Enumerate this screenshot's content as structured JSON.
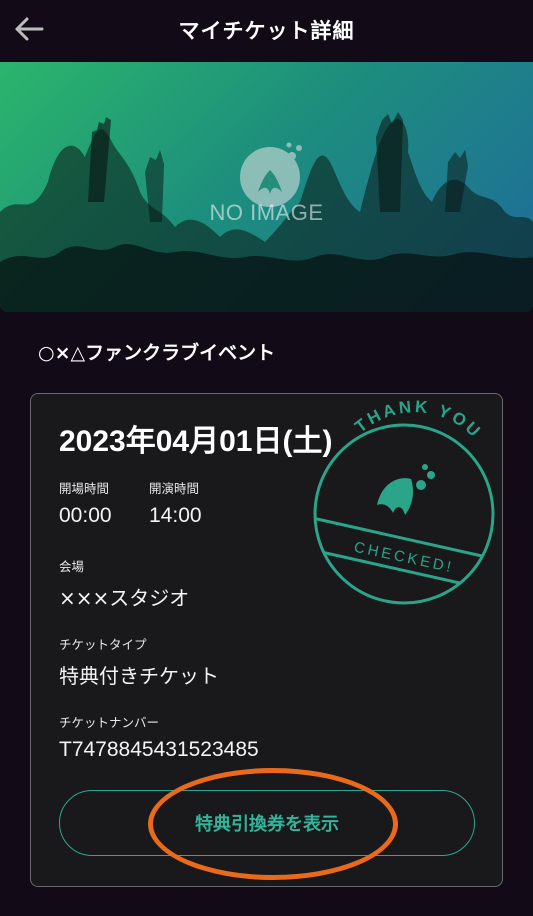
{
  "header": {
    "title": "マイチケット詳細",
    "back_icon": "arrow-left-icon"
  },
  "hero": {
    "placeholder_text": "NO IMAGE",
    "gradient": [
      "#2bb56b",
      "#1d8f7d",
      "#1f6a9c"
    ]
  },
  "event": {
    "title": "○×△ファンクラブイベント"
  },
  "ticket": {
    "date": "2023年04月01日(土)",
    "open_label": "開場時間",
    "open_time": "00:00",
    "start_label": "開演時間",
    "start_time": "14:00",
    "venue_label": "会場",
    "venue": "×××スタジオ",
    "type_label": "チケットタイプ",
    "type": "特典付きチケット",
    "number_label": "チケットナンバー",
    "number": "T7478845431523485"
  },
  "stamp": {
    "top_text": "THANK YOU",
    "band_text": "CHECKED!",
    "color": "#2aa58a"
  },
  "actions": {
    "benefit_button": "特典引換券を表示"
  },
  "colors": {
    "background": "#120a17",
    "accent": "#33b39a",
    "annotation": "#ea6a1c"
  }
}
